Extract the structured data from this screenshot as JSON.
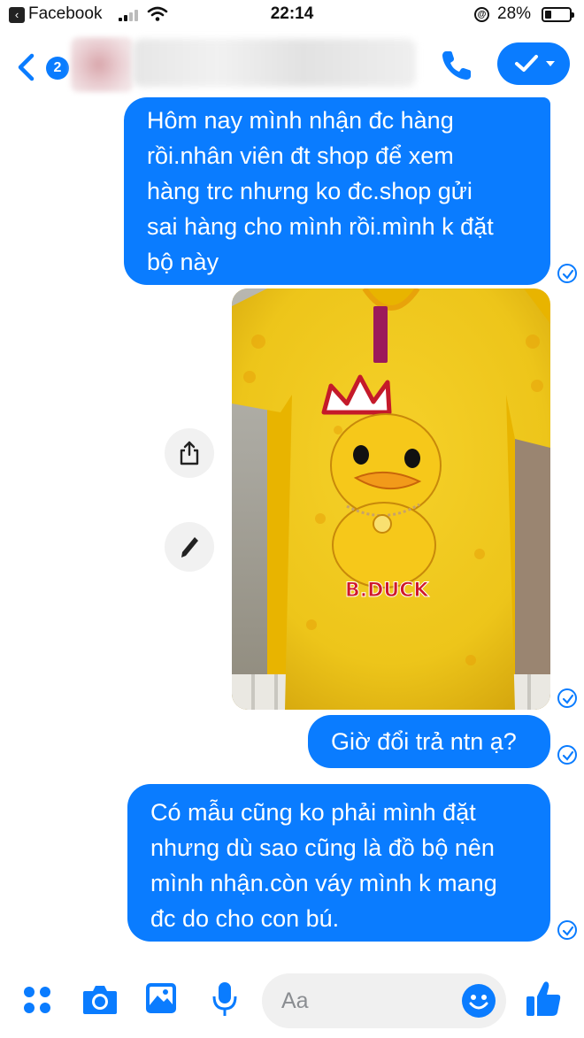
{
  "status_bar": {
    "back_app": "Facebook",
    "time": "22:14",
    "battery_percent": "28%",
    "battery_level": 0.28,
    "signal_bars": 2,
    "icons": [
      "back-app-icon",
      "signal-icon",
      "wifi-icon",
      "orientation-lock-icon",
      "battery-icon"
    ]
  },
  "header": {
    "back_badge_count": "2",
    "icons": [
      "chevron-left-icon",
      "phone-icon",
      "checkmark-icon",
      "caret-down-icon"
    ]
  },
  "messages": [
    {
      "id": "msg1",
      "sender": "me",
      "lines": [
        "Hôm nay mình nhận đc hàng",
        "rồi.nhân viên đt shop để xem",
        "hàng trc nhưng ko đc.shop gửi",
        "sai hàng cho mình rồi.mình k đặt",
        "bộ này"
      ],
      "status": "delivered"
    },
    {
      "id": "msg2",
      "sender": "me",
      "type": "photo",
      "photo_print_text": "B.DUCK",
      "status": "delivered"
    },
    {
      "id": "msg3",
      "sender": "me",
      "lines": [
        "Giờ đổi trả ntn ạ?"
      ],
      "status": "delivered"
    },
    {
      "id": "msg4",
      "sender": "me",
      "lines": [
        "Có mẫu cũng ko phải mình đặt",
        "nhưng dù sao cũng là đồ bộ nên",
        "mình nhận.còn váy mình k mang",
        "đc do cho con bú."
      ],
      "status": "delivered"
    }
  ],
  "photo_actions": [
    "share-icon",
    "edit-pencil-icon"
  ],
  "composer": {
    "placeholder": "Aa",
    "icons": [
      "apps-grid-icon",
      "camera-icon",
      "gallery-icon",
      "microphone-icon",
      "emoji-icon",
      "thumbs-up-icon"
    ]
  },
  "colors": {
    "accent": "#0a7cff",
    "bubble_text": "#ffffff",
    "composer_field": "#f0f0f0",
    "placeholder": "#8a8d91"
  }
}
